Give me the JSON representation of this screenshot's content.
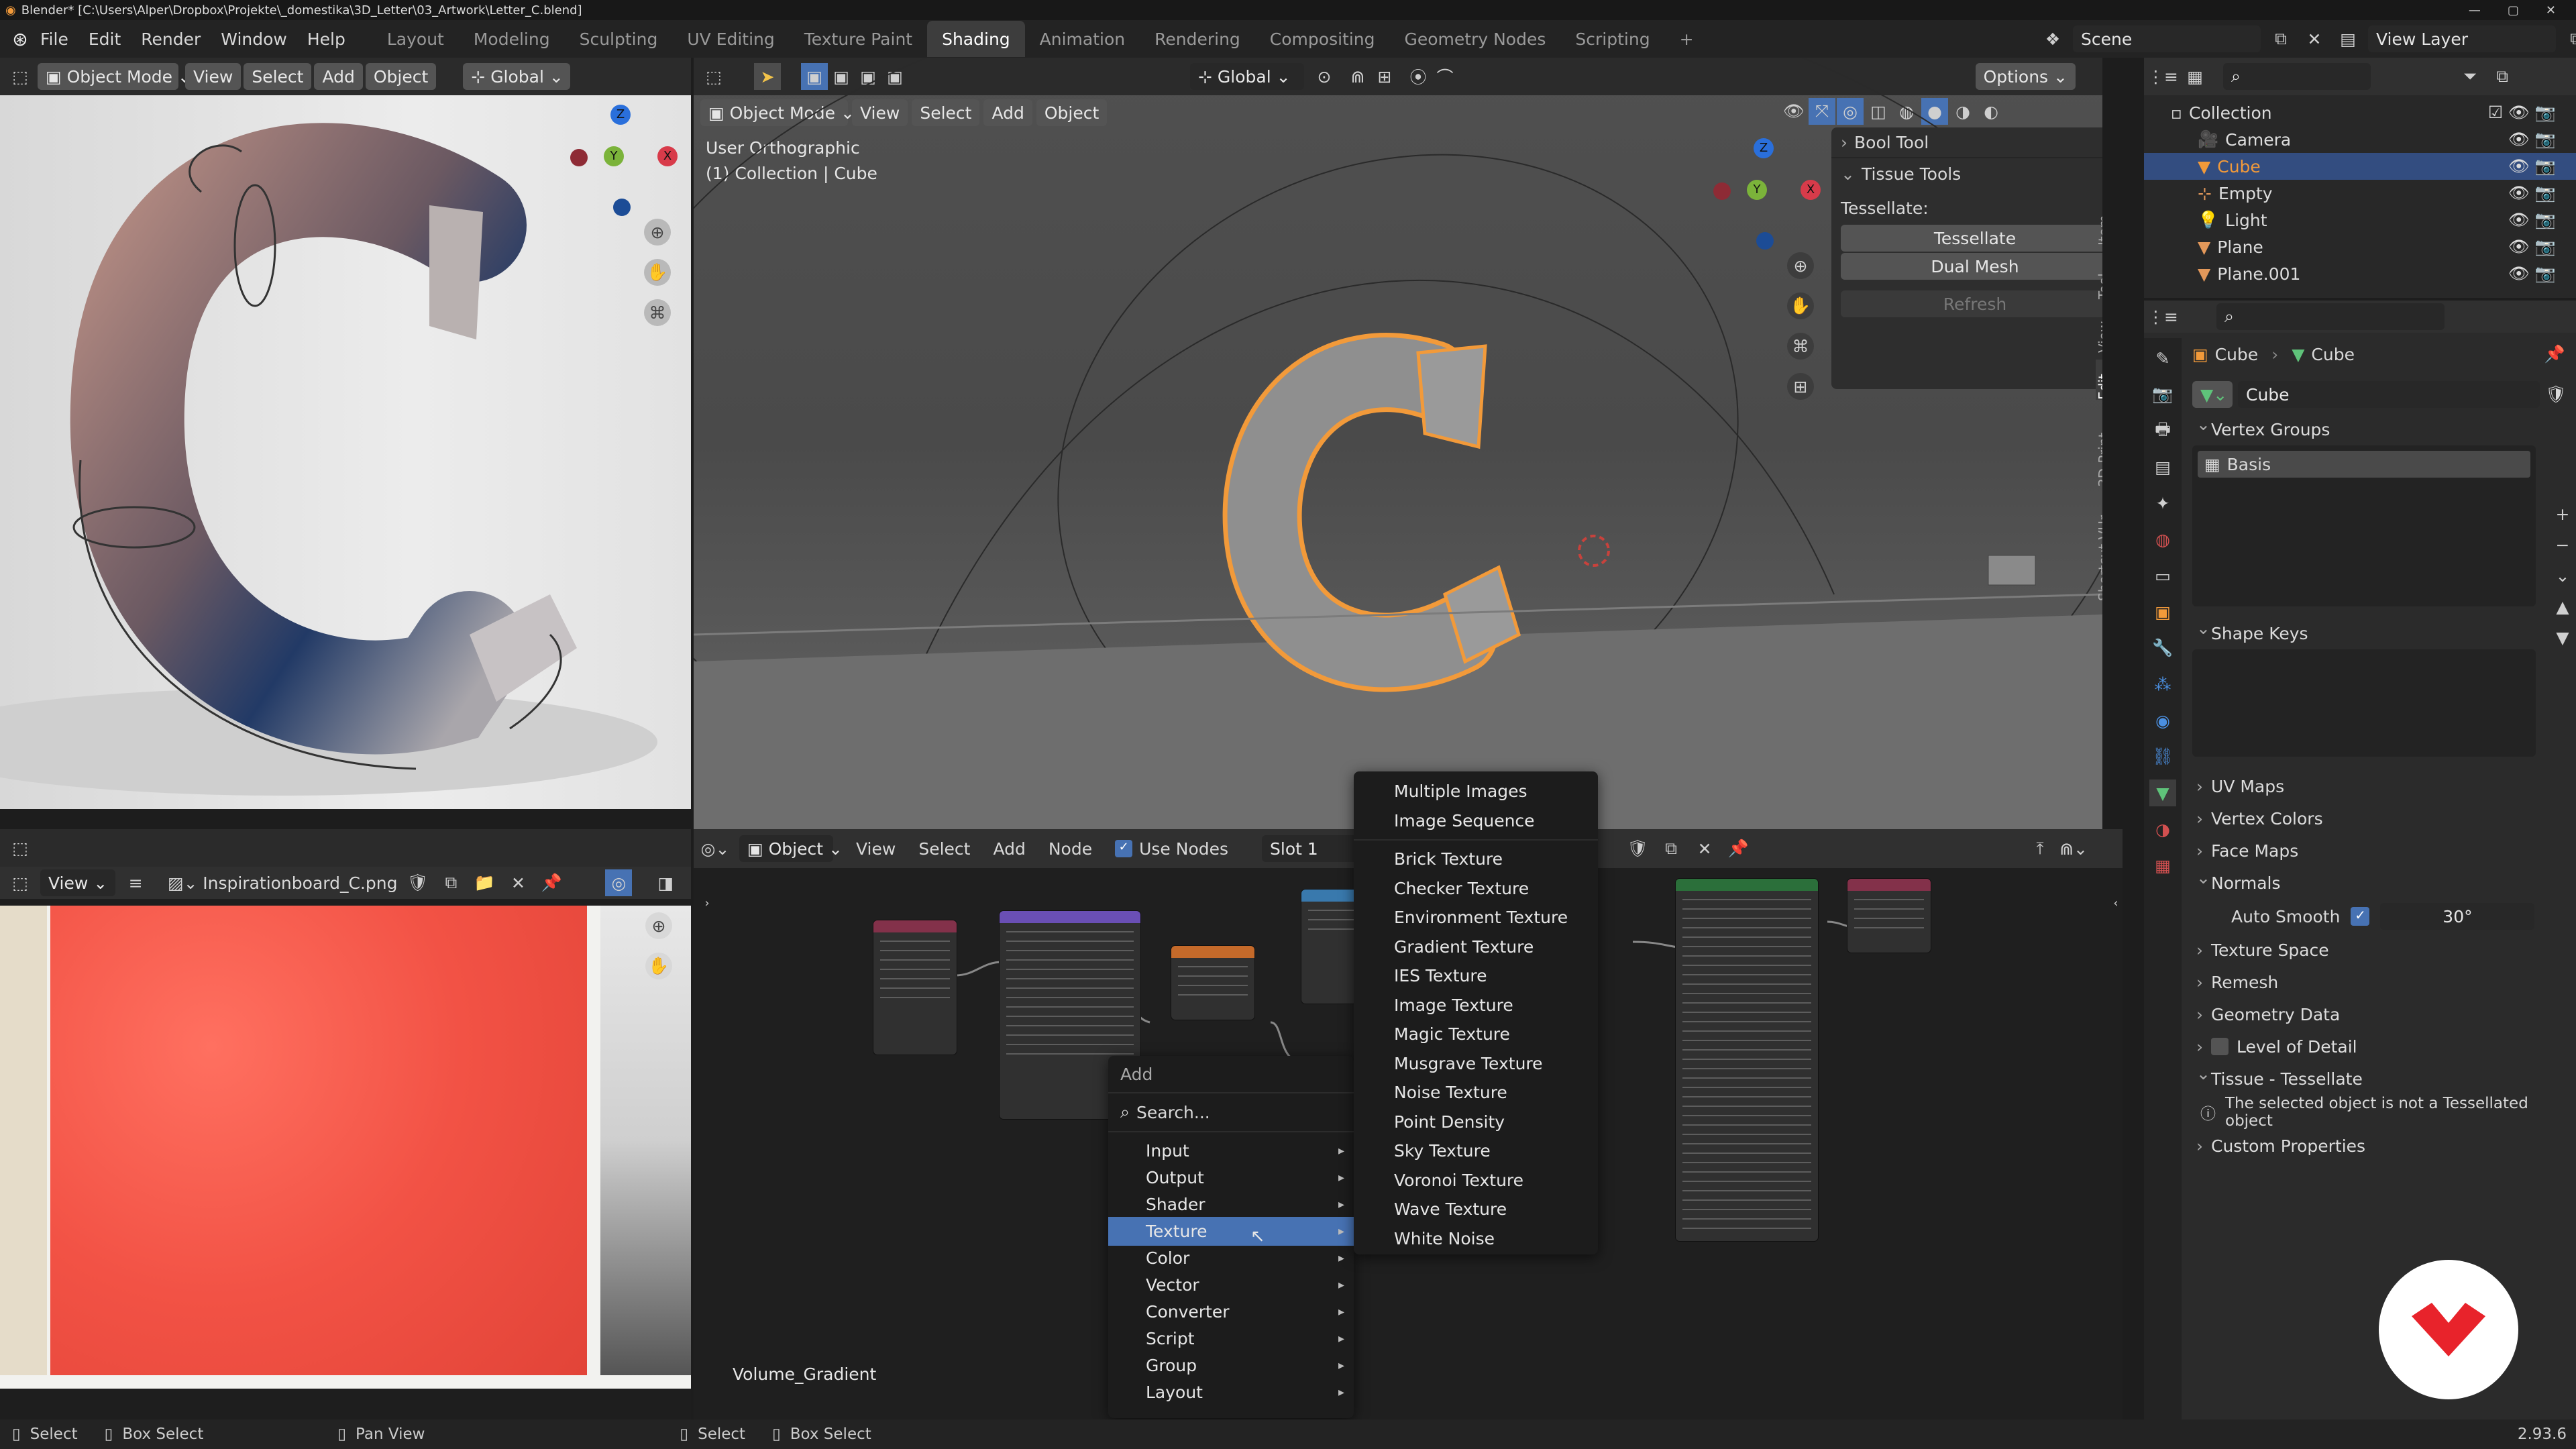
{
  "title_bar": {
    "text": "Blender* [C:\\Users\\Alper\\Dropbox\\Projekte\\_domestika\\3D_Letter\\03_Artwork\\Letter_C.blend]"
  },
  "menu": {
    "items": [
      "File",
      "Edit",
      "Render",
      "Window",
      "Help"
    ]
  },
  "workspaces": [
    "Layout",
    "Modeling",
    "Sculpting",
    "UV Editing",
    "Texture Paint",
    "Shading",
    "Animation",
    "Rendering",
    "Compositing",
    "Geometry Nodes",
    "Scripting"
  ],
  "active_workspace": "Shading",
  "scene": {
    "name": "Scene",
    "view_layer": "View Layer"
  },
  "left_viewport": {
    "mode": "Object Mode",
    "menus": [
      "View",
      "Select",
      "Add",
      "Object"
    ],
    "orientation": "Global"
  },
  "main_viewport": {
    "mode": "Object Mode",
    "menus": [
      "View",
      "Select",
      "Add",
      "Object"
    ],
    "orientation": "Global",
    "options": "Options",
    "view_name": "User Orthographic",
    "collection_info": "(1) Collection | Cube"
  },
  "n_panel": {
    "bool_tool": "Bool Tool",
    "tissue_tools": "Tissue Tools",
    "tessellate_label": "Tessellate:",
    "tessellate_btn": "Tessellate",
    "dual_mesh_btn": "Dual Mesh",
    "refresh_btn": "Refresh",
    "side_tabs": [
      "Item",
      "Tool",
      "View",
      "Edit",
      "3D-Print",
      "Shortcut VUr"
    ]
  },
  "outliner": {
    "items": [
      {
        "name": "Collection",
        "depth": 0
      },
      {
        "name": "Camera",
        "depth": 1
      },
      {
        "name": "Cube",
        "depth": 1,
        "selected": true
      },
      {
        "name": "Empty",
        "depth": 1
      },
      {
        "name": "Light",
        "depth": 1
      },
      {
        "name": "Plane",
        "depth": 1
      },
      {
        "name": "Plane.001",
        "depth": 1
      }
    ]
  },
  "properties": {
    "breadcrumb_obj": "Cube",
    "breadcrumb_mesh": "Cube",
    "mesh_name": "Cube",
    "vertex_groups": "Vertex Groups",
    "vg_item": "Basis",
    "shape_keys": "Shape Keys",
    "sections": [
      "UV Maps",
      "Vertex Colors",
      "Face Maps"
    ],
    "normals": "Normals",
    "auto_smooth": "Auto Smooth",
    "auto_smooth_angle": "30°",
    "sections2": [
      "Texture Space",
      "Remesh",
      "Geometry Data"
    ],
    "lod": "Level of Detail",
    "tissue": "Tissue - Tessellate",
    "tissue_msg": "The selected object is not a Tessellated object",
    "custom_props": "Custom Properties"
  },
  "image_editor": {
    "view": "View",
    "image_name": "Inspirationboard_C.png"
  },
  "node_editor": {
    "object": "Object",
    "menus": [
      "View",
      "Select",
      "Add",
      "Node"
    ],
    "use_nodes": "Use Nodes",
    "slot": "Slot 1",
    "material_name": "Volume_Gradient"
  },
  "add_menu": {
    "title": "Add",
    "search": "Search...",
    "items": [
      "Input",
      "Output",
      "Shader",
      "Texture",
      "Color",
      "Vector",
      "Converter",
      "Script",
      "Group",
      "Layout"
    ],
    "active": "Texture"
  },
  "texture_submenu": {
    "items": [
      "Multiple Images",
      "Image Sequence",
      "Brick Texture",
      "Checker Texture",
      "Environment Texture",
      "Gradient Texture",
      "IES Texture",
      "Image Texture",
      "Magic Texture",
      "Musgrave Texture",
      "Noise Texture",
      "Point Density",
      "Sky Texture",
      "Voronoi Texture",
      "Wave Texture",
      "White Noise"
    ]
  },
  "status_bar": {
    "select": "Select",
    "box_select": "Box Select",
    "pan_view": "Pan View",
    "select2": "Select",
    "box_select2": "Box Select",
    "version": "2.93.6"
  },
  "colors": {
    "accent_blue": "#4772b3",
    "selected_orange": "#f29a3a",
    "node_input": "#83314a",
    "node_shader": "#2b6f3a",
    "node_vector": "#6a4fb5",
    "node_texture": "#c56a2a",
    "logo_red": "#e8232b"
  }
}
